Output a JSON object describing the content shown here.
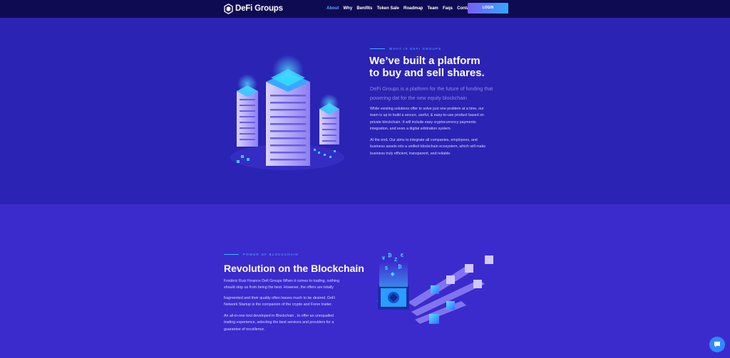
{
  "brand": {
    "name": "DeFi Groups"
  },
  "nav": {
    "items": [
      "About",
      "Why",
      "Benifits",
      "Token Sale",
      "Roadmap",
      "Team",
      "Faqs",
      "Contact"
    ],
    "active": "About",
    "login_label": "LOGIN"
  },
  "about": {
    "eyebrow": "WHAT IS DEFI GROUPS",
    "title_line1": "We’ve built a platform",
    "title_line2": "to buy and sell shares.",
    "lead_line1": "DeFi Groups is a platform for the future of funding that",
    "lead_line2": "powering dat for the new equity blockchain",
    "p1_lines": [
      "While existing solutions offer to solve just one problem at a time, our",
      "team is up to build a secure, useful, & easy-to-use product based on",
      "private blockchain. It will include easy cryptocurrency payments",
      "integration, and even a digital arbitration system."
    ],
    "p2_lines": [
      "At the end, Our aims to integrate all companies, employees, and",
      "business assets into a unified blockchain ecosystem, which will make",
      "business truly efficient, transparent, and reliable."
    ],
    "illustration": "server-towers-illustration"
  },
  "power": {
    "eyebrow": "POWER OF BLOCKCHAIN",
    "title": "Revolution on the Blockchain",
    "p1_lines": [
      "Frédéric Ruiz Finance Defi Groups When it comes to trading, nothing",
      "should stop us from being the best. However, the offers are totally"
    ],
    "p2_lines": [
      "fragmented and their quality often leaves much to be desired. DeFi",
      "Network Startup is the companion of the crypto and Forex trader."
    ],
    "p3_lines": [
      "An all-in-one tool developed in Blockchain , to offer an unequalled",
      "trading experience, selecting the best services and providers for a",
      "guarantee of excellence."
    ],
    "illustration": "blockchain-cubes-illustration"
  },
  "chat": {
    "icon": "chat-icon"
  },
  "colors": {
    "nav_bg": "#0f0b52",
    "section1_bg": "#2b23b4",
    "section2_bg": "#3b2bcd",
    "accent": "#3fb4ff"
  }
}
